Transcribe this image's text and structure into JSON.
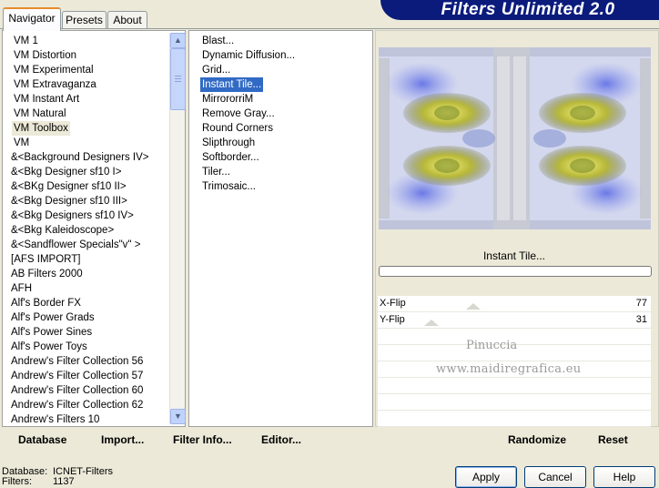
{
  "banner": {
    "title": "Filters Unlimited 2.0"
  },
  "tabs": [
    {
      "label": "Navigator",
      "active": true
    },
    {
      "label": "Presets",
      "active": false
    },
    {
      "label": "About",
      "active": false
    }
  ],
  "categories": [
    "VM 1",
    "VM Distortion",
    "VM Experimental",
    "VM Extravaganza",
    "VM Instant Art",
    "VM Natural",
    "VM Toolbox",
    "VM",
    "&<Background Designers IV>",
    "&<Bkg Designer sf10 I>",
    "&<BKg Designer sf10 II>",
    "&<Bkg Designer sf10 III>",
    "&<Bkg Designers sf10 IV>",
    "&<Bkg Kaleidoscope>",
    "&<Sandflower Specials\"v\" >",
    "[AFS IMPORT]",
    "AB Filters 2000",
    "AFH",
    "Alf's Border FX",
    "Alf's Power Grads",
    "Alf's Power Sines",
    "Alf's Power Toys",
    "Andrew's Filter Collection 56",
    "Andrew's Filter Collection 57",
    "Andrew's Filter Collection 60",
    "Andrew's Filter Collection 62",
    "Andrew's Filters 10"
  ],
  "selected_category": "VM Toolbox",
  "filters": [
    "Blast...",
    "Dynamic Diffusion...",
    "Grid...",
    "Instant Tile...",
    "MirrororriM",
    "Remove Gray...",
    "Round Corners",
    "Slipthrough",
    "Softborder...",
    "Tiler...",
    "Trimosaic..."
  ],
  "selected_filter": "Instant Tile...",
  "preview": {
    "filter_name": "Instant Tile...",
    "progress": 0
  },
  "params": [
    {
      "label": "X-Flip",
      "value": "77",
      "level": 0.302
    },
    {
      "label": "Y-Flip",
      "value": "31",
      "level": 0.122
    }
  ],
  "watermark": {
    "line1": "Pinuccia",
    "line2": "www.maidiregrafica.eu"
  },
  "toolbar": {
    "database": "Database",
    "import": "Import...",
    "filter_info": "Filter Info...",
    "editor": "Editor...",
    "randomize": "Randomize",
    "reset": "Reset"
  },
  "status": {
    "database_label": "Database:",
    "database_value": "ICNET-Filters",
    "filters_label": "Filters:",
    "filters_value": "1137"
  },
  "buttons": {
    "apply": "Apply",
    "cancel": "Cancel",
    "help": "Help"
  }
}
